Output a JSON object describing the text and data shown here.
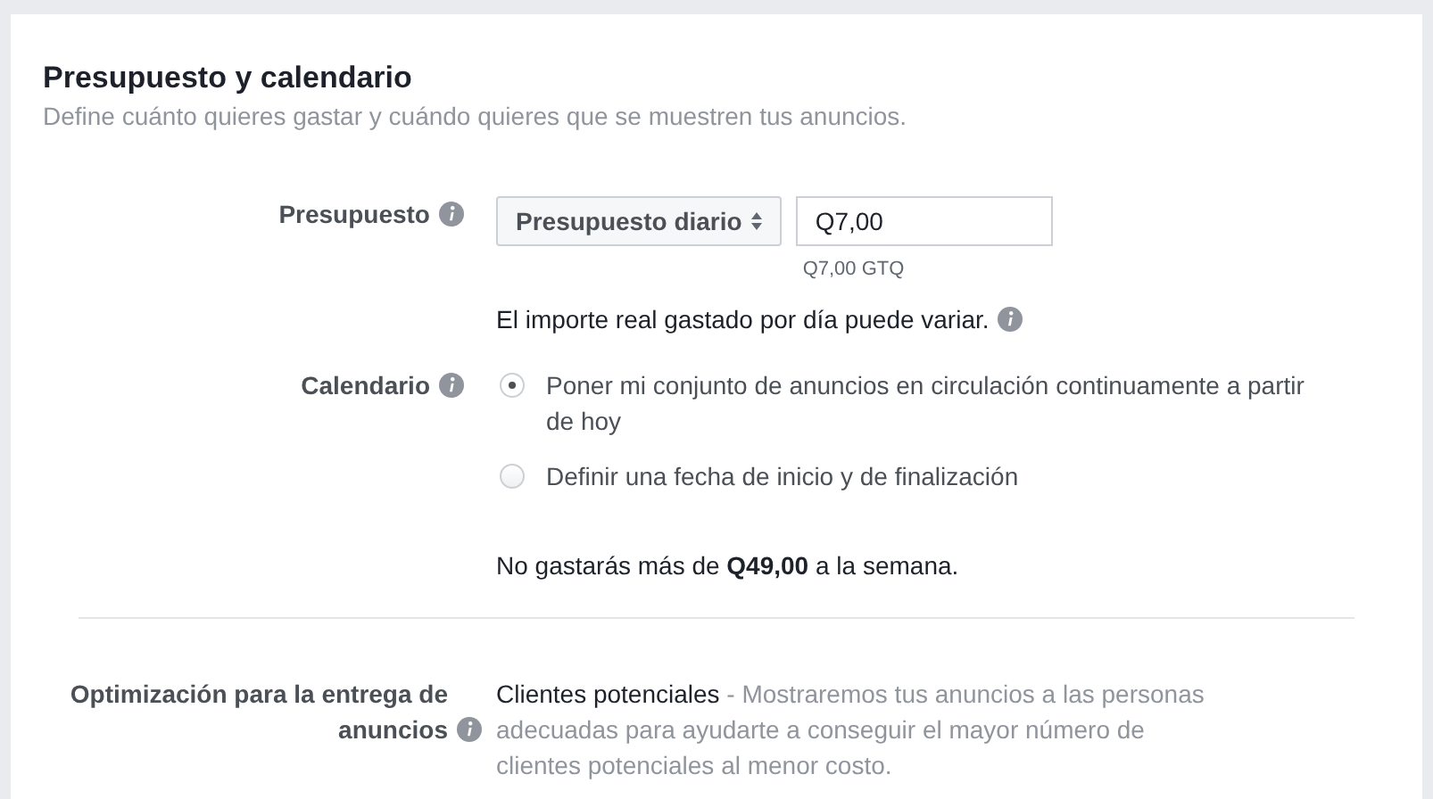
{
  "section": {
    "title": "Presupuesto y calendario",
    "subtitle": "Define cuánto quieres gastar y cuándo quieres que se muestren tus anuncios."
  },
  "budget": {
    "label": "Presupuesto",
    "type_dropdown": "Presupuesto diario",
    "amount": "Q7,00",
    "amount_note": "Q7,00 GTQ",
    "variance_note": "El importe real gastado por día puede variar."
  },
  "schedule": {
    "label": "Calendario",
    "options": [
      {
        "label": "Poner mi conjunto de anuncios en circulación continuamente a partir de hoy",
        "selected": true
      },
      {
        "label": "Definir una fecha de inicio y de finalización",
        "selected": false
      }
    ],
    "weekly_note": "No gastarás más de **Q49,00** a la semana."
  },
  "optimization": {
    "label": "Optimización para la entrega de anuncios",
    "value": "Clientes potenciales",
    "description": " - Mostraremos tus anuncios a las personas adecuadas para ayudarte a conseguir el mayor número de clientes potenciales al menor costo."
  }
}
